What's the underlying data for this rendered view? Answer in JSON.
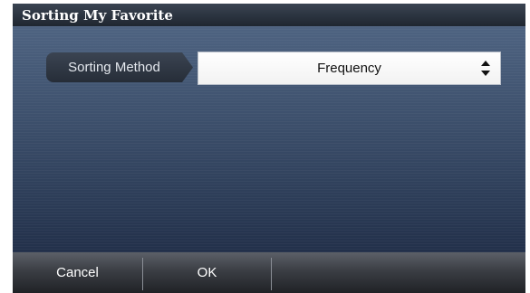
{
  "window": {
    "title": "Sorting My Favorite"
  },
  "setting": {
    "label": "Sorting Method",
    "value": "Frequency",
    "icon": "up-down-arrows-icon"
  },
  "footer": {
    "cancel_label": "Cancel",
    "ok_label": "OK"
  },
  "colors": {
    "content_background": "#3b4e6a",
    "title_bar": "#2a323e",
    "footer_bar": "#3b3e44",
    "select_background": "#ffffff"
  }
}
